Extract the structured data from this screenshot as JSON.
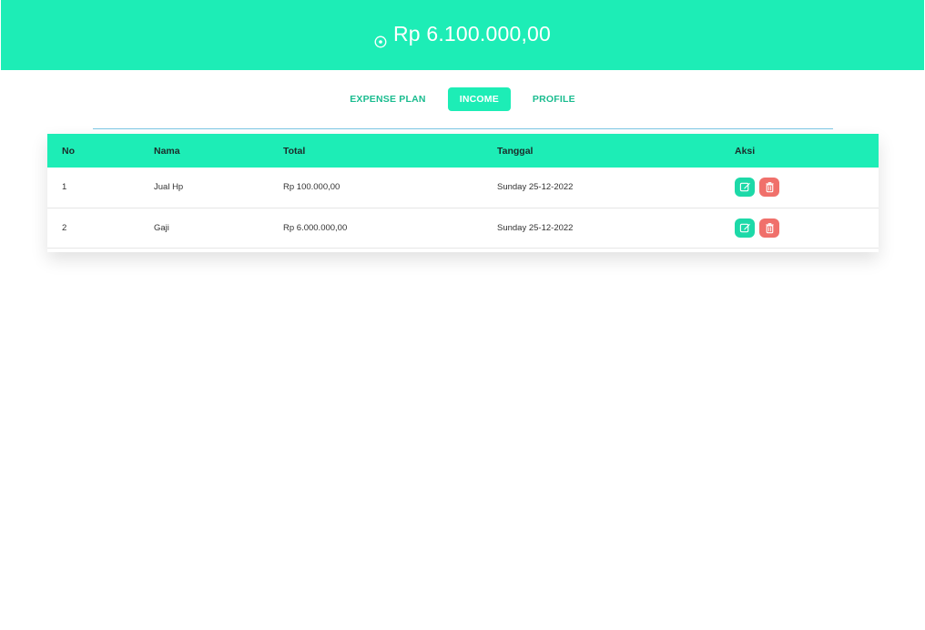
{
  "header": {
    "balance": "Rp 6.100.000,00",
    "balance_icon": "coin-circle-icon",
    "bg_color": "#1dedb6"
  },
  "nav": {
    "tabs": [
      {
        "label": "EXPENSE PLAN",
        "active": false
      },
      {
        "label": "INCOME",
        "active": true
      },
      {
        "label": "PROFILE",
        "active": false
      }
    ]
  },
  "table": {
    "columns": [
      "No",
      "Nama",
      "Total",
      "Tanggal",
      "Aksi"
    ],
    "rows": [
      {
        "no": "1",
        "nama": "Jual Hp",
        "total": "Rp 100.000,00",
        "tanggal": "Sunday 25-12-2022"
      },
      {
        "no": "2",
        "nama": "Gaji",
        "total": "Rp 6.000.000,00",
        "tanggal": "Sunday 25-12-2022"
      }
    ],
    "edit_icon": "edit-icon",
    "delete_icon": "trash-icon",
    "edit_color": "#1dd9a8",
    "delete_color": "#f0706b"
  }
}
